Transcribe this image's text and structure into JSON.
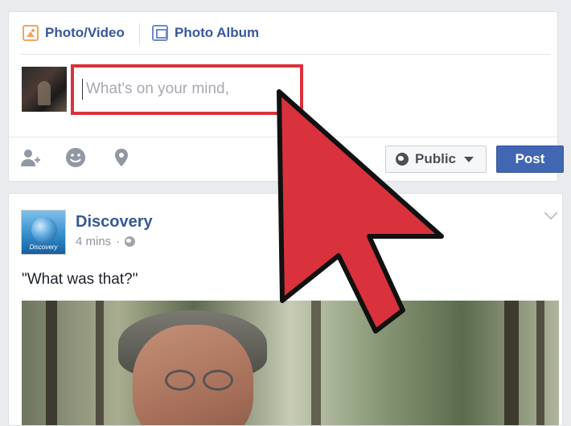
{
  "composer": {
    "tabs": [
      {
        "label": "Photo/Video",
        "icon": "photo-video-icon"
      },
      {
        "label": "Photo Album",
        "icon": "photo-album-icon"
      }
    ],
    "status_placeholder": "What's on your mind,",
    "actions": [
      {
        "icon": "tag-friends-icon"
      },
      {
        "icon": "feeling-emoji-icon"
      },
      {
        "icon": "location-pin-icon"
      }
    ],
    "privacy_label": "Public",
    "post_label": "Post"
  },
  "feed_post": {
    "page_name": "Discovery",
    "logo_text": "Discovery",
    "time": "4 mins",
    "separator": "·",
    "text": "\"What was that?\""
  },
  "colors": {
    "highlight": "#d9323c",
    "brand_blue": "#4267b2",
    "link": "#365899"
  }
}
